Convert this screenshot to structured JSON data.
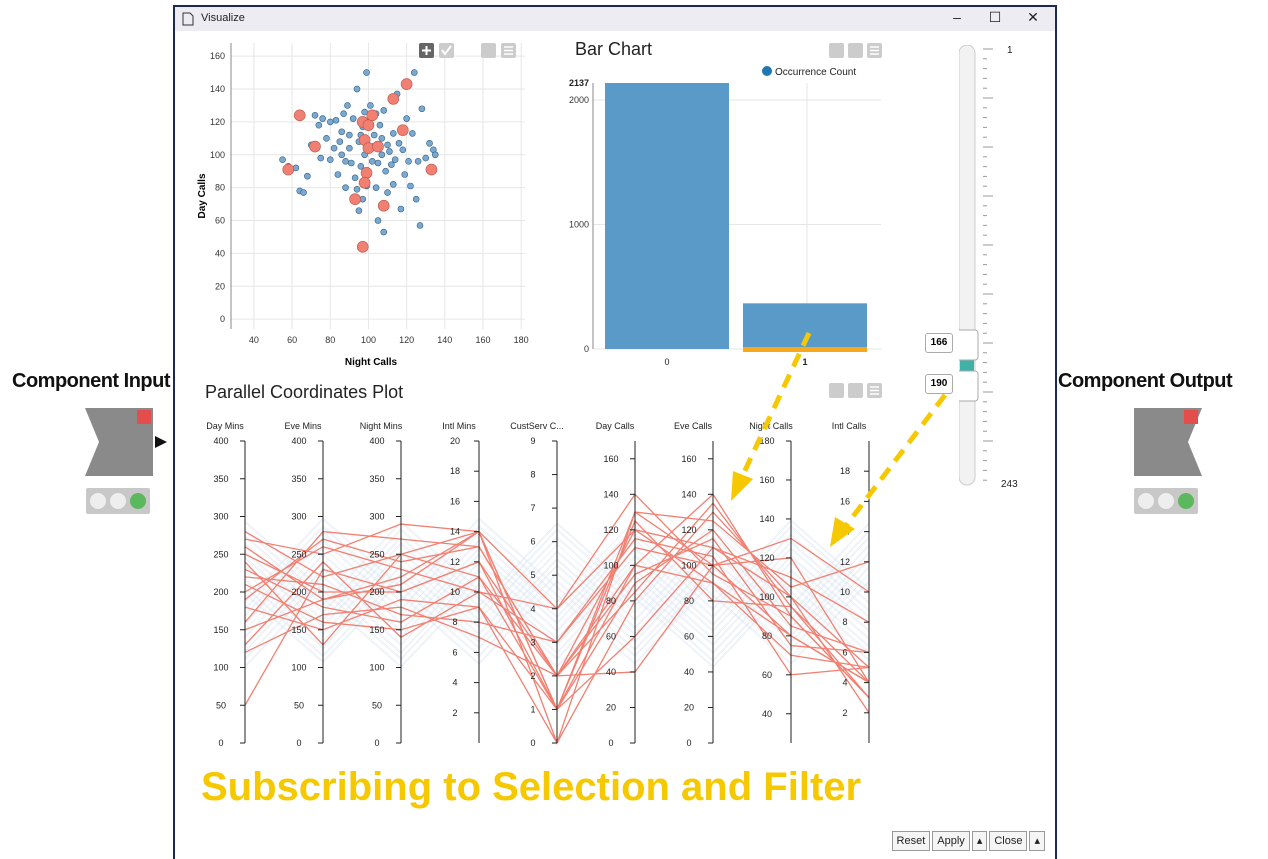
{
  "window": {
    "title": "Visualize",
    "minimize": "–",
    "maximize": "☐",
    "close": "✕"
  },
  "component_input": {
    "label": "Component Input"
  },
  "component_output": {
    "label": "Component Output"
  },
  "scatter": {
    "xlabel": "Night Calls",
    "ylabel": "Day Calls",
    "x_ticks": [
      40,
      60,
      80,
      100,
      120,
      140,
      160,
      180
    ],
    "y_ticks": [
      0,
      20,
      40,
      60,
      80,
      100,
      120,
      140,
      160
    ],
    "points_blue": [
      [
        55,
        97
      ],
      [
        58,
        93
      ],
      [
        62,
        92
      ],
      [
        64,
        78
      ],
      [
        66,
        77
      ],
      [
        68,
        87
      ],
      [
        70,
        106
      ],
      [
        72,
        124
      ],
      [
        74,
        118
      ],
      [
        75,
        98
      ],
      [
        76,
        122
      ],
      [
        78,
        110
      ],
      [
        80,
        97
      ],
      [
        80,
        120
      ],
      [
        82,
        104
      ],
      [
        83,
        121
      ],
      [
        84,
        88
      ],
      [
        85,
        108
      ],
      [
        86,
        100
      ],
      [
        86,
        114
      ],
      [
        87,
        125
      ],
      [
        88,
        96
      ],
      [
        88,
        80
      ],
      [
        89,
        130
      ],
      [
        90,
        112
      ],
      [
        90,
        104
      ],
      [
        91,
        95
      ],
      [
        92,
        122
      ],
      [
        93,
        86
      ],
      [
        94,
        140
      ],
      [
        94,
        79
      ],
      [
        95,
        66
      ],
      [
        95,
        108
      ],
      [
        96,
        93
      ],
      [
        96,
        112
      ],
      [
        97,
        73
      ],
      [
        97,
        117
      ],
      [
        98,
        100
      ],
      [
        98,
        126
      ],
      [
        99,
        150
      ],
      [
        99,
        81
      ],
      [
        100,
        120
      ],
      [
        100,
        88
      ],
      [
        101,
        130
      ],
      [
        102,
        105
      ],
      [
        102,
        96
      ],
      [
        103,
        112
      ],
      [
        104,
        80
      ],
      [
        104,
        125
      ],
      [
        105,
        95
      ],
      [
        105,
        60
      ],
      [
        106,
        118
      ],
      [
        107,
        110
      ],
      [
        107,
        100
      ],
      [
        108,
        53
      ],
      [
        108,
        127
      ],
      [
        109,
        90
      ],
      [
        110,
        106
      ],
      [
        110,
        77
      ],
      [
        111,
        102
      ],
      [
        112,
        94
      ],
      [
        113,
        113
      ],
      [
        113,
        82
      ],
      [
        114,
        97
      ],
      [
        115,
        137
      ],
      [
        116,
        107
      ],
      [
        117,
        67
      ],
      [
        118,
        103
      ],
      [
        119,
        88
      ],
      [
        120,
        122
      ],
      [
        121,
        96
      ],
      [
        122,
        81
      ],
      [
        123,
        113
      ],
      [
        124,
        150
      ],
      [
        125,
        73
      ],
      [
        126,
        96
      ],
      [
        127,
        57
      ],
      [
        128,
        128
      ],
      [
        130,
        98
      ],
      [
        132,
        107
      ],
      [
        133,
        91
      ],
      [
        134,
        103
      ],
      [
        135,
        100
      ]
    ],
    "points_red": [
      [
        58,
        91
      ],
      [
        64,
        124
      ],
      [
        72,
        105
      ],
      [
        97,
        120
      ],
      [
        100,
        118
      ],
      [
        102,
        124
      ],
      [
        98,
        109
      ],
      [
        99,
        89
      ],
      [
        98,
        83
      ],
      [
        97,
        44
      ],
      [
        93,
        73
      ],
      [
        100,
        104
      ],
      [
        105,
        105
      ],
      [
        108,
        69
      ],
      [
        113,
        134
      ],
      [
        118,
        115
      ],
      [
        120,
        143
      ],
      [
        133,
        91
      ]
    ]
  },
  "bar_chart": {
    "title": "Bar Chart",
    "legend": "Occurrence Count",
    "categories": [
      "0",
      "1"
    ],
    "values": [
      2137,
      367
    ],
    "max_label": "2137",
    "y_ticks": [
      0,
      1000,
      2000
    ]
  },
  "slider": {
    "min": "1",
    "max": "243",
    "low": "166",
    "high": "190"
  },
  "parallel": {
    "title": "Parallel Coordinates Plot",
    "axes": [
      {
        "name": "Day Mins",
        "ticks": [
          "0",
          "50",
          "100",
          "150",
          "200",
          "250",
          "300",
          "350",
          "400"
        ],
        "min": 0,
        "max": 400
      },
      {
        "name": "Eve Mins",
        "ticks": [
          "0",
          "50",
          "100",
          "150",
          "200",
          "250",
          "300",
          "350",
          "400"
        ],
        "min": 0,
        "max": 400
      },
      {
        "name": "Night Mins",
        "ticks": [
          "0",
          "50",
          "100",
          "150",
          "200",
          "250",
          "300",
          "350",
          "400"
        ],
        "min": 0,
        "max": 400
      },
      {
        "name": "Intl Mins",
        "ticks": [
          "2",
          "4",
          "6",
          "8",
          "10",
          "12",
          "14",
          "16",
          "18",
          "20"
        ],
        "min": 0,
        "max": 20
      },
      {
        "name": "CustServ C...",
        "ticks": [
          "0",
          "1",
          "2",
          "3",
          "4",
          "5",
          "6",
          "7",
          "8",
          "9"
        ],
        "min": 0,
        "max": 9
      },
      {
        "name": "Day Calls",
        "ticks": [
          "0",
          "20",
          "40",
          "60",
          "80",
          "100",
          "120",
          "140",
          "160"
        ],
        "min": 0,
        "max": 170
      },
      {
        "name": "Eve Calls",
        "ticks": [
          "0",
          "20",
          "40",
          "60",
          "80",
          "100",
          "120",
          "140",
          "160"
        ],
        "min": 0,
        "max": 170
      },
      {
        "name": "Night Calls",
        "ticks": [
          "40",
          "60",
          "80",
          "100",
          "120",
          "140",
          "160",
          "180"
        ],
        "min": 25,
        "max": 180
      },
      {
        "name": "Intl Calls",
        "ticks": [
          "2",
          "4",
          "6",
          "8",
          "10",
          "12",
          "14",
          "16",
          "18"
        ],
        "min": 0,
        "max": 20
      }
    ],
    "lines_red": [
      [
        280,
        220,
        250,
        14,
        1,
        130,
        100,
        120,
        4
      ],
      [
        270,
        250,
        290,
        14,
        4,
        120,
        110,
        100,
        5
      ],
      [
        250,
        200,
        200,
        12,
        2,
        100,
        140,
        90,
        3
      ],
      [
        230,
        180,
        160,
        11,
        1,
        90,
        120,
        85,
        6
      ],
      [
        200,
        260,
        230,
        10,
        3,
        110,
        100,
        80,
        4
      ],
      [
        180,
        150,
        190,
        9,
        0,
        80,
        130,
        100,
        2
      ],
      [
        160,
        280,
        270,
        13,
        2,
        120,
        90,
        70,
        5
      ],
      [
        150,
        190,
        210,
        14,
        1,
        60,
        110,
        110,
        8
      ],
      [
        130,
        240,
        140,
        10,
        4,
        140,
        95,
        90,
        3
      ],
      [
        120,
        170,
        180,
        7,
        2,
        40,
        100,
        130,
        10
      ],
      [
        50,
        230,
        200,
        12,
        1,
        125,
        80,
        95,
        4
      ],
      [
        220,
        210,
        170,
        8,
        3,
        115,
        105,
        60,
        5
      ],
      [
        240,
        130,
        250,
        11,
        2,
        95,
        115,
        75,
        6
      ],
      [
        260,
        190,
        220,
        14,
        0,
        130,
        125,
        105,
        12
      ],
      [
        210,
        160,
        150,
        9,
        1,
        100,
        90,
        80,
        4
      ],
      [
        190,
        270,
        240,
        13,
        2,
        85,
        135,
        95,
        3
      ]
    ]
  },
  "buttons": {
    "reset": "Reset",
    "apply": "Apply",
    "close": "Close"
  },
  "caption": "Subscribing to Selection and Filter",
  "colors": {
    "bar": "#5a9ac9",
    "selected": "#f28072",
    "highlight": "#f7a91b",
    "arrow": "#f5c800",
    "thumb": "#3fb1a5"
  }
}
